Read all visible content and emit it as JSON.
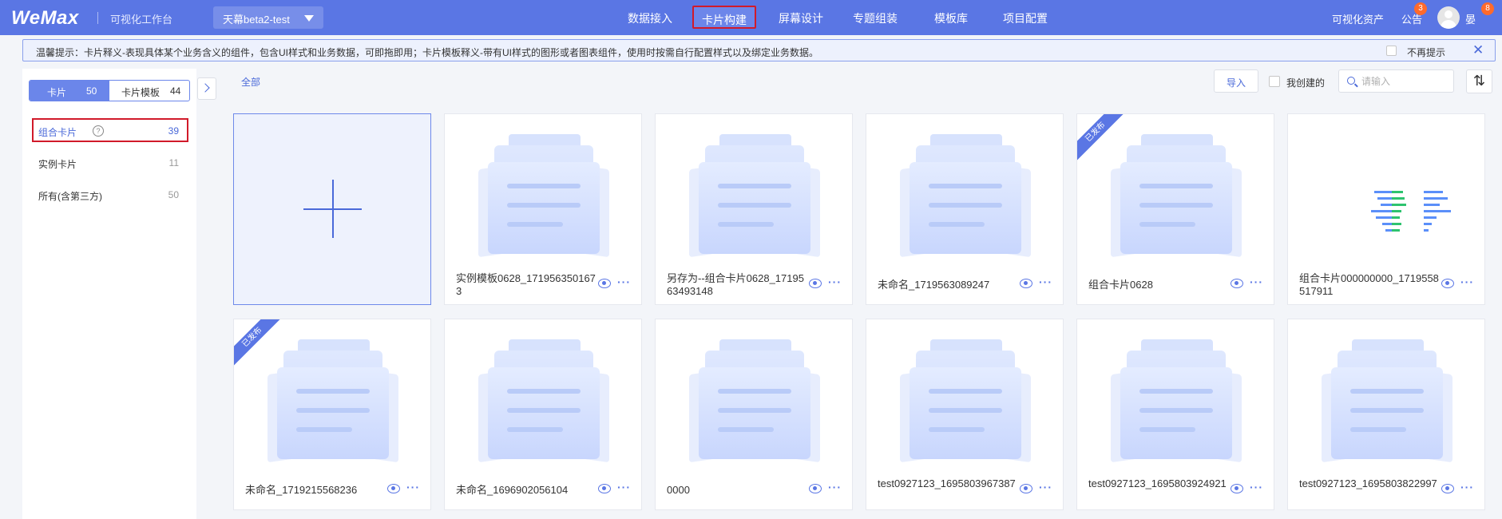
{
  "header": {
    "logo": "WeMax",
    "workbench": "可视化工作台",
    "project": "天幕beta2-test",
    "nav": [
      {
        "label": "数据接入",
        "active": false
      },
      {
        "label": "卡片构建",
        "active": true
      },
      {
        "label": "屏幕设计",
        "active": false
      },
      {
        "label": "专题组装",
        "active": false
      },
      {
        "label": "模板库",
        "active": false
      },
      {
        "label": "项目配置",
        "active": false
      }
    ],
    "assets": "可视化资产",
    "notice": "公告",
    "notice_badge": "3",
    "user": "晏",
    "user_badge": "8"
  },
  "tip": {
    "text": "温馨提示：卡片释义-表现具体某个业务含义的组件，包含UI样式和业务数据，可即拖即用；卡片模板释义-带有UI样式的图形或者图表组件，使用时按需自行配置样式以及绑定业务数据。",
    "no_show": "不再提示",
    "close": "✕"
  },
  "sidebar": {
    "tabs": [
      {
        "label": "卡片",
        "count": "50"
      },
      {
        "label": "卡片模板",
        "count": "44"
      }
    ],
    "categories": [
      {
        "label": "组合卡片",
        "count": "39",
        "active": true,
        "help": "?"
      },
      {
        "label": "实例卡片",
        "count": "11",
        "active": false
      },
      {
        "label": "所有(含第三方)",
        "count": "50",
        "active": false
      }
    ]
  },
  "toolbar": {
    "all": "全部",
    "import": "导入",
    "mine": "我创建的",
    "search_placeholder": "请输入",
    "sort": "⇅"
  },
  "cards": [
    {
      "name": "实例模板0628_1719563501673",
      "published": false,
      "thumb": "folder"
    },
    {
      "name": "另存为--组合卡片0628_1719563493148",
      "published": false,
      "thumb": "folder"
    },
    {
      "name": "未命名_1719563089247",
      "published": false,
      "thumb": "folder"
    },
    {
      "name": "组合卡片0628",
      "published": true,
      "thumb": "folder"
    },
    {
      "name": "组合卡片000000000_1719558517911",
      "published": false,
      "thumb": "chart"
    },
    {
      "name": "未命名_1719215568236",
      "published": true,
      "thumb": "folder"
    },
    {
      "name": "未命名_1696902056104",
      "published": false,
      "thumb": "folder"
    },
    {
      "name": "0000",
      "published": false,
      "thumb": "folder"
    },
    {
      "name": "test0927123_1695803967387",
      "published": false,
      "thumb": "folder"
    },
    {
      "name": "test0927123_1695803924921",
      "published": false,
      "thumb": "folder"
    },
    {
      "name": "test0927123_1695803822997",
      "published": false,
      "thumb": "folder"
    }
  ],
  "published_label": "已发布",
  "more": "···",
  "colors": {
    "primary": "#5a76e4",
    "accent": "#4a69d9",
    "highlight": "#d11a2a"
  }
}
